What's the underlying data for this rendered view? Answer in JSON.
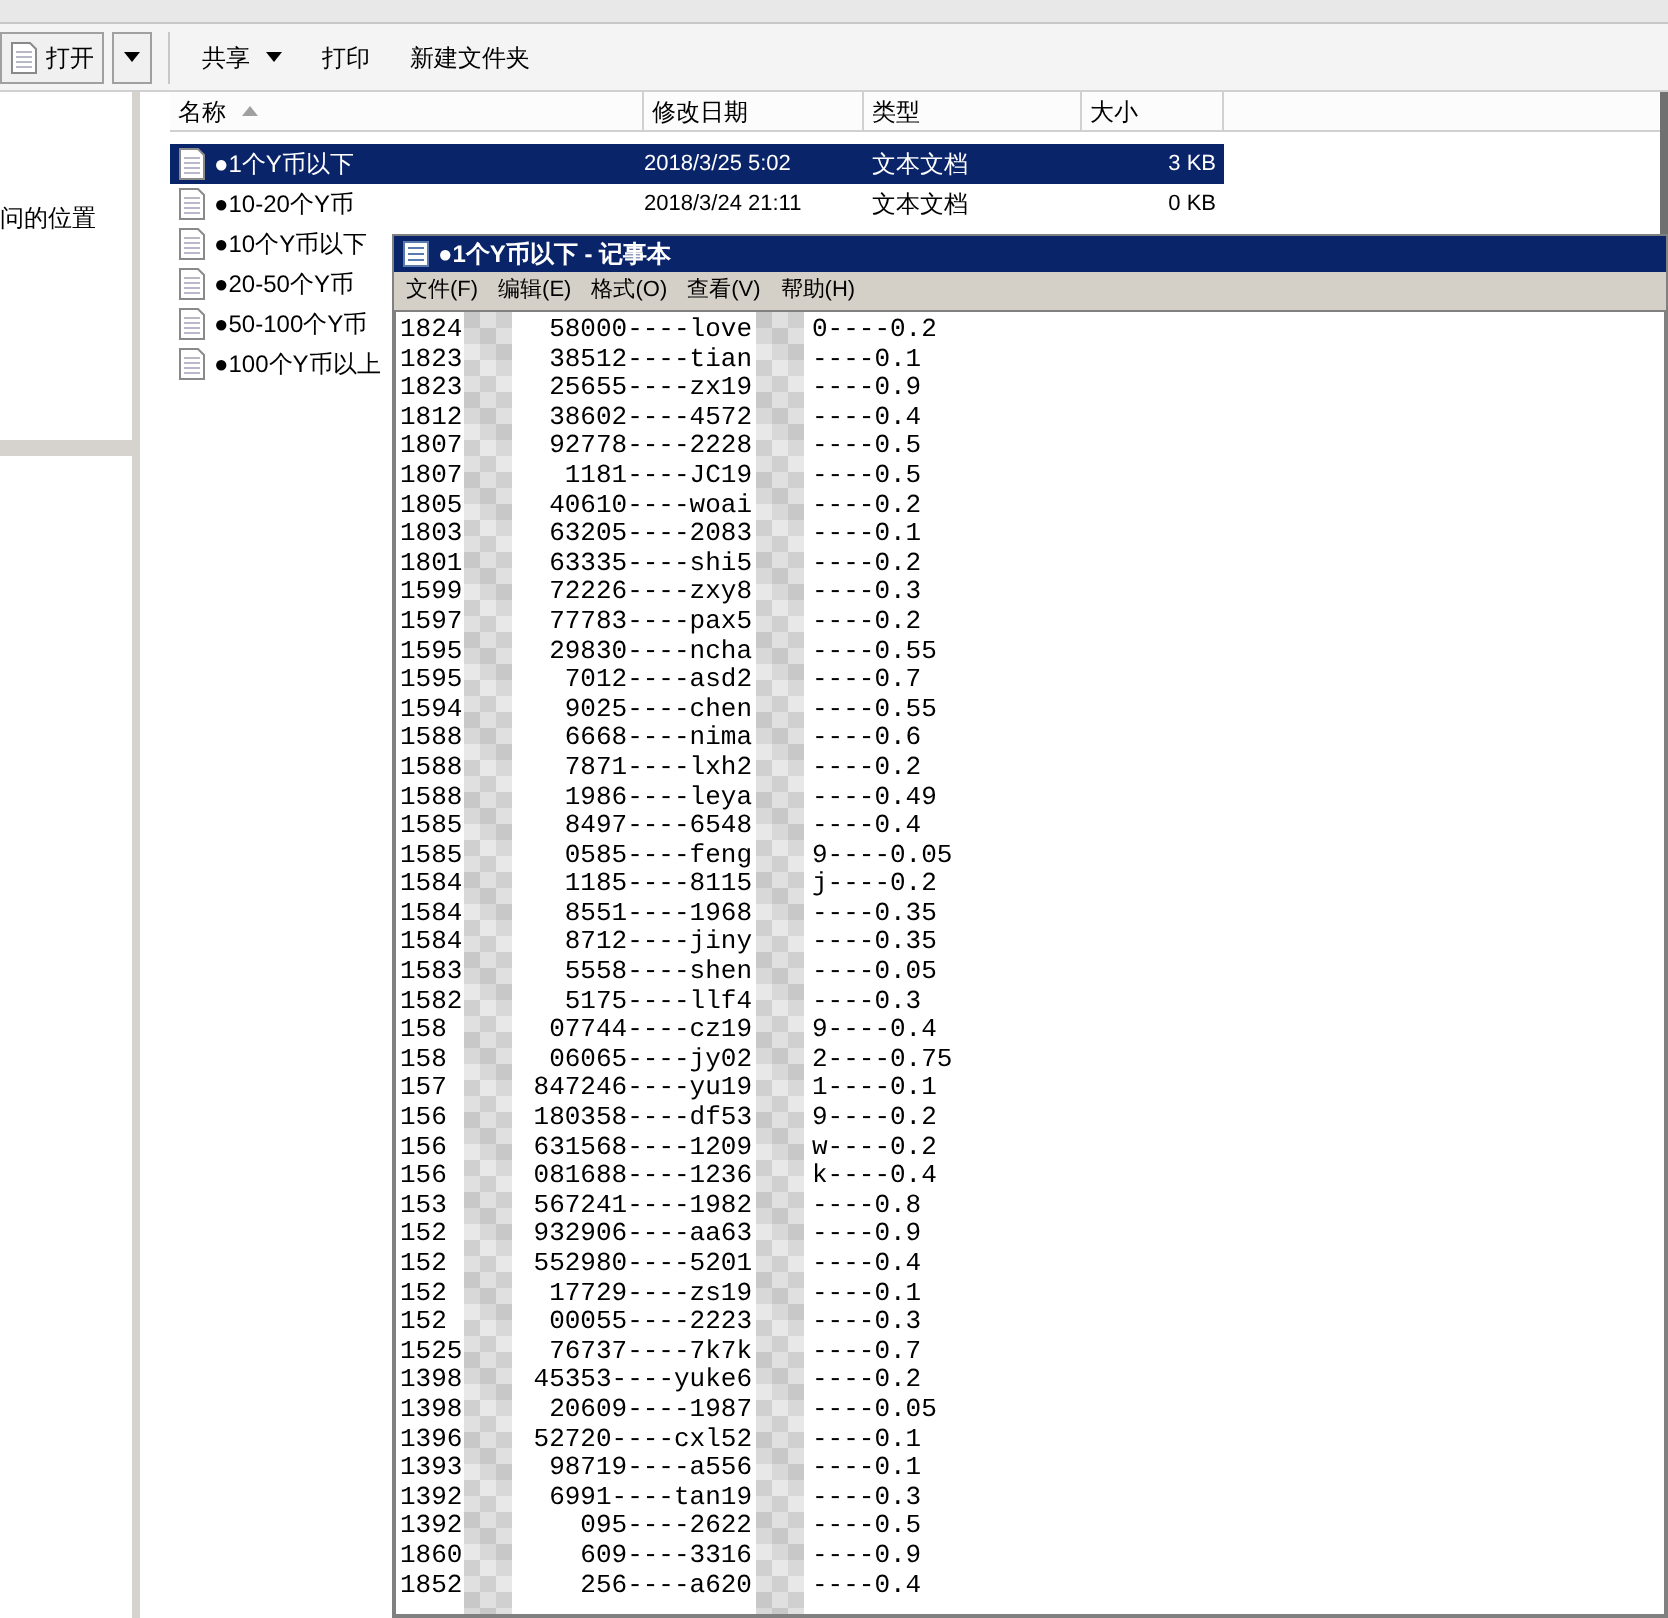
{
  "toolbar": {
    "open_button": {
      "label": "打开"
    },
    "items": [
      {
        "label": "共享",
        "dropdown": true
      },
      {
        "label": "打印",
        "dropdown": false
      },
      {
        "label": "新建文件夹",
        "dropdown": false
      }
    ]
  },
  "nav_pane": {
    "items": [
      "问的位置"
    ]
  },
  "file_list": {
    "columns": [
      {
        "label": "名称",
        "sorted": true
      },
      {
        "label": "修改日期",
        "sorted": false
      },
      {
        "label": "类型",
        "sorted": false
      },
      {
        "label": "大小",
        "sorted": false
      }
    ],
    "rows": [
      {
        "name": "●1个Y币以下",
        "date": "2018/3/25 5:02",
        "type": "文本文档",
        "size": "3 KB",
        "selected": true
      },
      {
        "name": "●10-20个Y币",
        "date": "2018/3/24 21:11",
        "type": "文本文档",
        "size": "0 KB",
        "selected": false
      },
      {
        "name": "●10个Y币以下",
        "selected": false
      },
      {
        "name": "●20-50个Y币",
        "selected": false
      },
      {
        "name": "●50-100个Y币",
        "selected": false
      },
      {
        "name": "●100个Y币以上",
        "selected": false
      }
    ]
  },
  "notepad": {
    "title": "●1个Y币以下 - 记事本",
    "menu": [
      "文件(F)",
      "编辑(E)",
      "格式(O)",
      "查看(V)",
      "帮助(H)"
    ],
    "lines": [
      [
        "1824",
        "58000----love",
        "0----0.2"
      ],
      [
        "1823",
        "38512----tian",
        "----0.1"
      ],
      [
        "1823",
        "25655----zx19",
        "----0.9"
      ],
      [
        "1812",
        "38602----4572",
        "----0.4"
      ],
      [
        "1807",
        "92778----2228",
        "----0.5"
      ],
      [
        "1807",
        "1181----JC19",
        "----0.5"
      ],
      [
        "1805",
        "40610----woai",
        "----0.2"
      ],
      [
        "1803",
        "63205----2083",
        "----0.1"
      ],
      [
        "1801",
        "63335----shi5",
        "----0.2"
      ],
      [
        "1599",
        "72226----zxy8",
        "----0.3"
      ],
      [
        "1597",
        "77783----pax5",
        "----0.2"
      ],
      [
        "1595",
        "29830----ncha",
        "----0.55"
      ],
      [
        "1595",
        "7012----asd2",
        "----0.7"
      ],
      [
        "1594",
        "9025----chen",
        "----0.55"
      ],
      [
        "1588",
        "6668----nima",
        "----0.6"
      ],
      [
        "1588",
        "7871----lxh2",
        "----0.2"
      ],
      [
        "1588",
        "1986----leya",
        "----0.49"
      ],
      [
        "1585",
        "8497----6548",
        "----0.4"
      ],
      [
        "1585",
        "0585----feng",
        "9----0.05"
      ],
      [
        "1584",
        "1185----8115",
        "j----0.2"
      ],
      [
        "1584",
        "8551----1968",
        "----0.35"
      ],
      [
        "1584",
        "8712----jiny",
        "----0.35"
      ],
      [
        "1583",
        "5558----shen",
        "----0.05"
      ],
      [
        "1582",
        "5175----llf4",
        "----0.3"
      ],
      [
        "158",
        "07744----cz19",
        "9----0.4"
      ],
      [
        "158",
        "06065----jy02",
        "2----0.75"
      ],
      [
        "157",
        "847246----yu19",
        "1----0.1"
      ],
      [
        "156",
        "180358----df53",
        "9----0.2"
      ],
      [
        "156",
        "631568----1209",
        "w----0.2"
      ],
      [
        "156",
        "081688----1236",
        "k----0.4"
      ],
      [
        "153",
        "567241----1982",
        "----0.8"
      ],
      [
        "152",
        "932906----aa63",
        "----0.9"
      ],
      [
        "152",
        "552980----5201",
        "----0.4"
      ],
      [
        "152",
        "17729----zs19",
        "----0.1"
      ],
      [
        "152",
        "00055----2223",
        "----0.3"
      ],
      [
        "1525",
        "76737----7k7k",
        "----0.7"
      ],
      [
        "1398",
        "45353----yuke6",
        "----0.2"
      ],
      [
        "1398",
        "20609----1987",
        "----0.05"
      ],
      [
        "1396",
        "52720----cxl52",
        "----0.1"
      ],
      [
        "1393",
        "98719----a556",
        "----0.1"
      ],
      [
        "1392",
        "6991----tan19",
        "----0.3"
      ],
      [
        "1392",
        "095----2622",
        "----0.5"
      ],
      [
        "1860",
        "609----3316",
        "----0.9"
      ],
      [
        "1852",
        "256----a620",
        "----0.4"
      ]
    ]
  }
}
